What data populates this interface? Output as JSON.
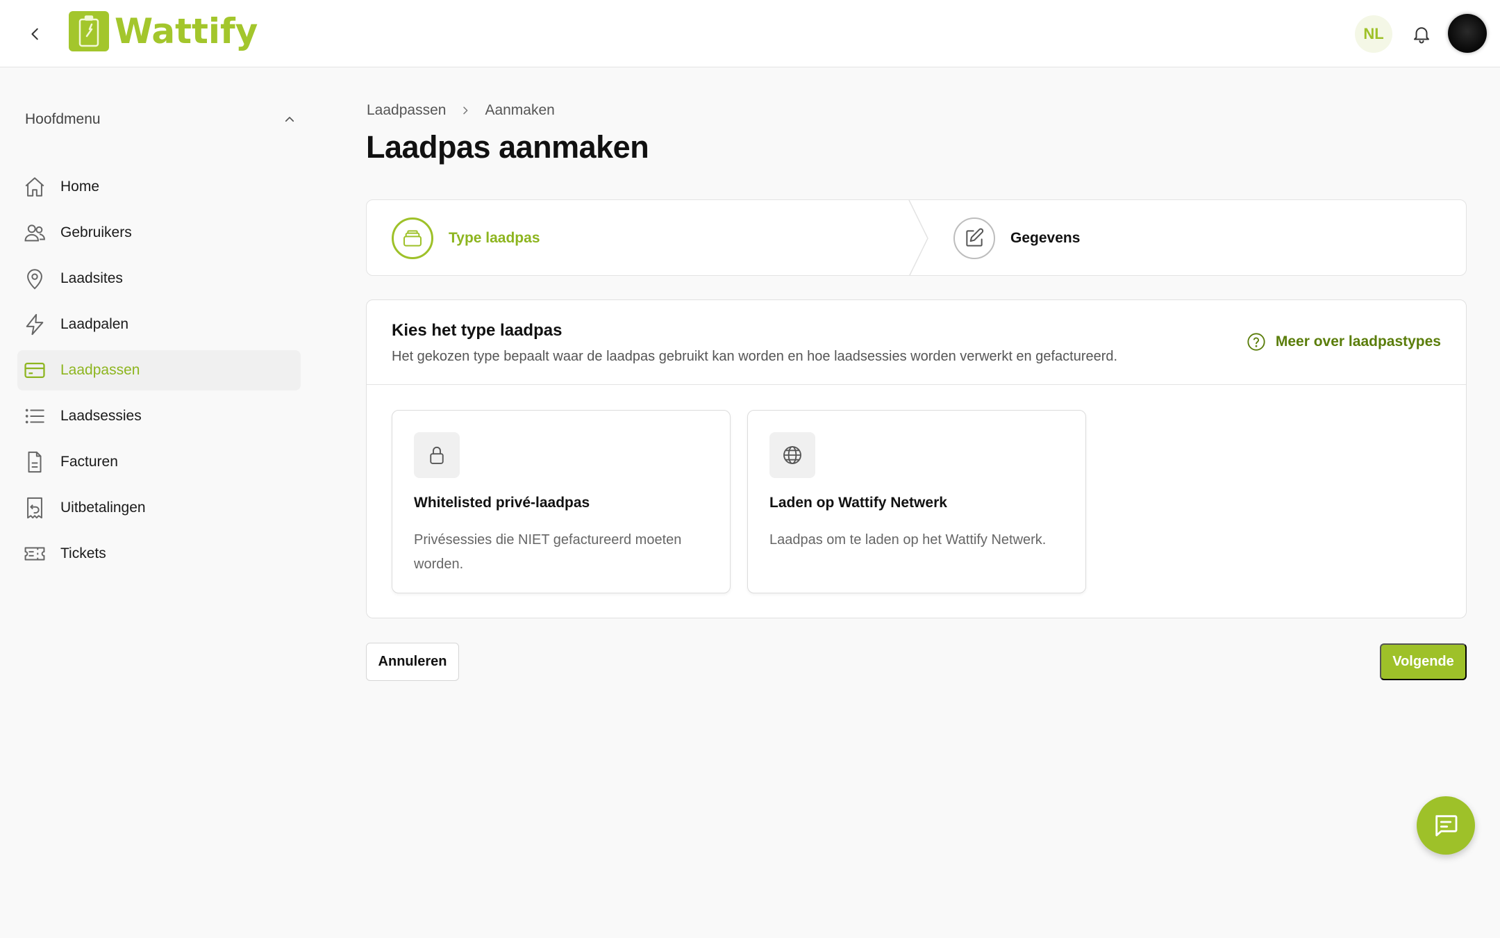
{
  "header": {
    "logo_text": "Wattify",
    "language": "NL"
  },
  "sidebar": {
    "menu_title": "Hoofdmenu",
    "items": [
      {
        "label": "Home",
        "icon": "home-icon",
        "active": false
      },
      {
        "label": "Gebruikers",
        "icon": "users-icon",
        "active": false
      },
      {
        "label": "Laadsites",
        "icon": "map-pin-icon",
        "active": false
      },
      {
        "label": "Laadpalen",
        "icon": "lightning-icon",
        "active": false
      },
      {
        "label": "Laadpassen",
        "icon": "credit-card-icon",
        "active": true
      },
      {
        "label": "Laadsessies",
        "icon": "list-icon",
        "active": false
      },
      {
        "label": "Facturen",
        "icon": "document-icon",
        "active": false
      },
      {
        "label": "Uitbetalingen",
        "icon": "receipt-icon",
        "active": false
      },
      {
        "label": "Tickets",
        "icon": "ticket-icon",
        "active": false
      }
    ]
  },
  "breadcrumb": [
    "Laadpassen",
    "Aanmaken"
  ],
  "page_title": "Laadpas aanmaken",
  "stepper": {
    "steps": [
      {
        "label": "Type laadpas",
        "icon": "card-stack-icon",
        "state": "current"
      },
      {
        "label": "Gegevens",
        "icon": "pencil-square-icon",
        "state": "upcoming"
      }
    ]
  },
  "card": {
    "title": "Kies het type laadpas",
    "subtitle": "Het gekozen type bepaalt waar de laadpas gebruikt kan worden en hoe laadsessies worden verwerkt en gefactureerd.",
    "help_link": "Meer over laadpastypes",
    "options": [
      {
        "title": "Whitelisted privé-laadpas",
        "description": "Privésessies die NIET gefactureerd moeten worden.",
        "icon": "lock-icon"
      },
      {
        "title": "Laden op Wattify Netwerk",
        "description": "Laadpas om te laden op het Wattify Netwerk.",
        "icon": "globe-icon"
      }
    ]
  },
  "actions": {
    "cancel": "Annuleren",
    "next": "Volgende"
  },
  "colors": {
    "accent": "#9ec129",
    "accent_dark": "#5a7d0a",
    "background": "#f9f9f9"
  }
}
